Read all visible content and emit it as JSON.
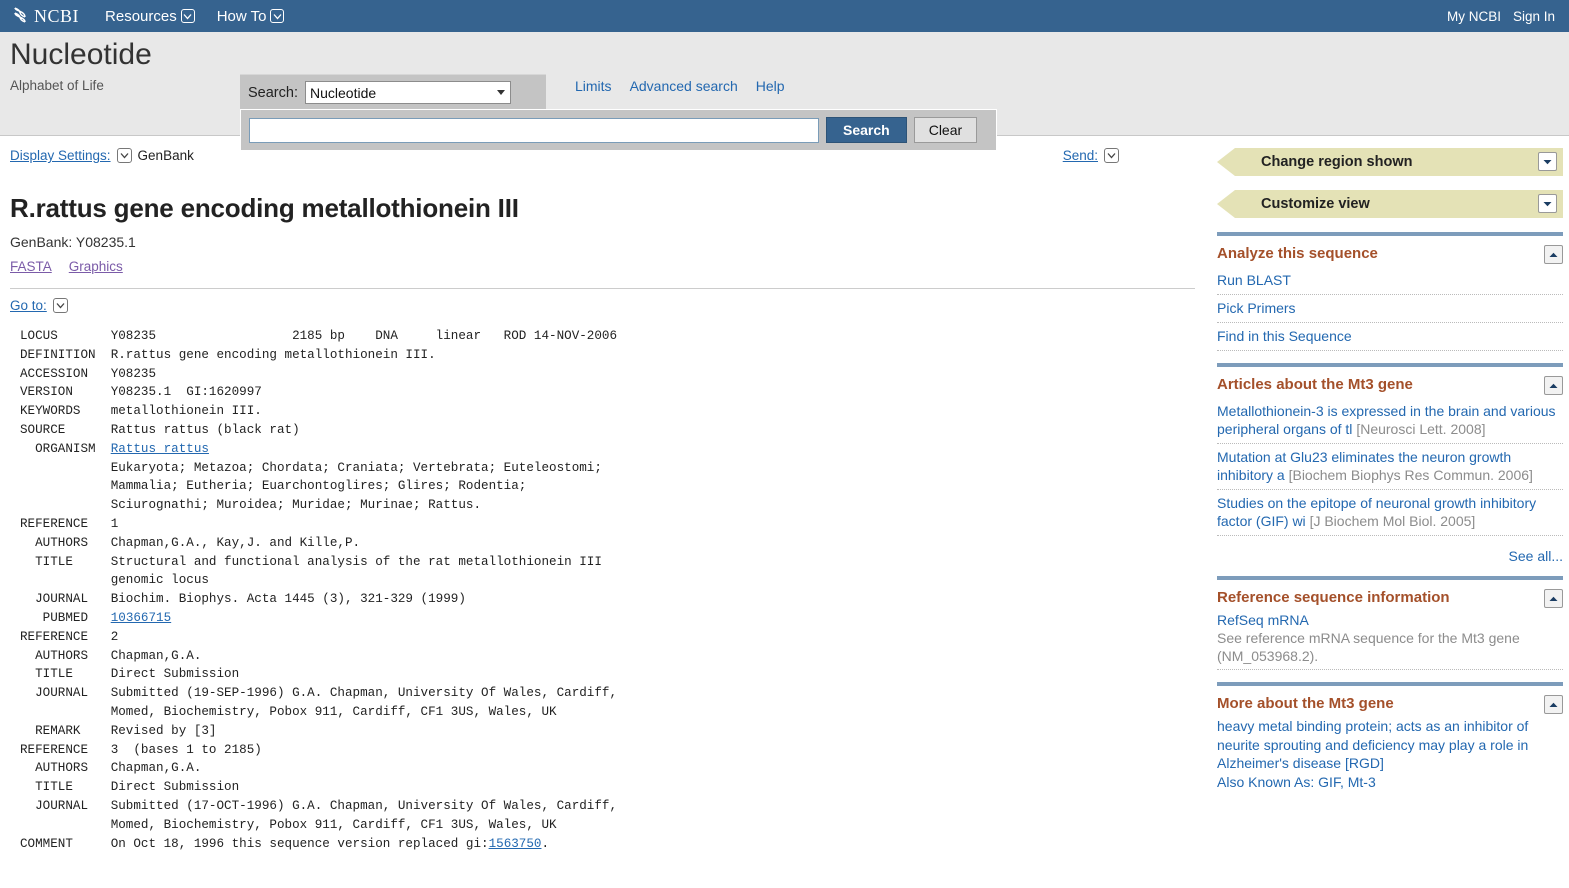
{
  "topbar": {
    "logo_text": "NCBI",
    "nav": [
      {
        "label": "Resources",
        "icon": "chevron-down-icon"
      },
      {
        "label": "How To",
        "icon": "chevron-down-icon"
      }
    ],
    "my_ncbi": "My NCBI",
    "sign_in": "Sign In"
  },
  "header": {
    "database_name": "Nucleotide",
    "tagline": "Alphabet of Life",
    "search_label": "Search:",
    "database_selected": "Nucleotide",
    "search_value": "",
    "search_placeholder": "",
    "search_button": "Search",
    "clear_button": "Clear",
    "links": [
      "Limits",
      "Advanced search",
      "Help"
    ]
  },
  "toolbar": {
    "display_settings": "Display Settings:",
    "display_format": "GenBank",
    "send": "Send:",
    "goto": "Go to:"
  },
  "record": {
    "title": "R.rattus gene encoding metallothionein III",
    "accession_line": "GenBank: Y08235.1",
    "links": [
      "FASTA",
      "Graphics"
    ]
  },
  "genbank": {
    "lines": [
      "LOCUS       Y08235                  2185 bp    DNA     linear   ROD 14-NOV-2006",
      "DEFINITION  R.rattus gene encoding metallothionein III.",
      "ACCESSION   Y08235",
      "VERSION     Y08235.1  GI:1620997",
      "KEYWORDS    metallothionein III.",
      "SOURCE      Rattus rattus (black rat)",
      "  ORGANISM  @LINK:Rattus rattus@",
      "            Eukaryota; Metazoa; Chordata; Craniata; Vertebrata; Euteleostomi;",
      "            Mammalia; Eutheria; Euarchontoglires; Glires; Rodentia;",
      "            Sciurognathi; Muroidea; Muridae; Murinae; Rattus.",
      "REFERENCE   1",
      "  AUTHORS   Chapman,G.A., Kay,J. and Kille,P.",
      "  TITLE     Structural and functional analysis of the rat metallothionein III",
      "            genomic locus",
      "  JOURNAL   Biochim. Biophys. Acta 1445 (3), 321-329 (1999)",
      "   PUBMED   @LINK:10366715@",
      "REFERENCE   2",
      "  AUTHORS   Chapman,G.A.",
      "  TITLE     Direct Submission",
      "  JOURNAL   Submitted (19-SEP-1996) G.A. Chapman, University Of Wales, Cardiff,",
      "            Momed, Biochemistry, Pobox 911, Cardiff, CF1 3US, Wales, UK",
      "  REMARK    Revised by [3]",
      "REFERENCE   3  (bases 1 to 2185)",
      "  AUTHORS   Chapman,G.A.",
      "  TITLE     Direct Submission",
      "  JOURNAL   Submitted (17-OCT-1996) G.A. Chapman, University Of Wales, Cardiff,",
      "            Momed, Biochemistry, Pobox 911, Cardiff, CF1 3US, Wales, UK",
      "COMMENT     On Oct 18, 1996 this sequence version replaced gi:@LINK:1563750@."
    ]
  },
  "sidebar": {
    "ribbons": [
      {
        "label": "Change region shown",
        "icon": "chevron-down-icon"
      },
      {
        "label": "Customize view",
        "icon": "chevron-down-icon"
      }
    ],
    "panels": [
      {
        "title": "Analyze this sequence",
        "collapse_icon": "chevron-up-icon",
        "links": [
          "Run BLAST",
          "Pick Primers",
          "Find in this Sequence"
        ]
      },
      {
        "title": "Articles about the Mt3 gene",
        "collapse_icon": "chevron-up-icon",
        "articles": [
          {
            "text": "Metallothionein-3 is expressed in the brain and various peripheral organs of tl",
            "cite": "[Neurosci Lett. 2008]"
          },
          {
            "text": "Mutation at Glu23 eliminates the neuron growth inhibitory a",
            "cite": "[Biochem Biophys Res Commun. 2006]"
          },
          {
            "text": "Studies on the epitope of neuronal growth inhibitory factor (GIF) wi",
            "cite": "[J Biochem Mol Biol. 2005]"
          }
        ],
        "see_all": "See all..."
      },
      {
        "title": "Reference sequence information",
        "collapse_icon": "chevron-up-icon",
        "refseq_title": "RefSeq mRNA",
        "refseq_desc": "See reference mRNA sequence for the Mt3 gene (NM_053968.2)."
      },
      {
        "title": "More about the Mt3 gene",
        "collapse_icon": "chevron-up-icon",
        "body": "heavy metal binding protein; acts as an inhibitor of neurite sprouting and deficiency may play a role in Alzheimer's disease [RGD]",
        "aka": "Also Known As: GIF, Mt-3"
      }
    ]
  },
  "colors": {
    "header_blue": "#36638f",
    "link_blue": "#2368b0",
    "ribbon_khaki": "#e4e2b6",
    "panel_title_brown": "#a4502a",
    "panel_bar_blue": "#7d9cbb",
    "purple_link": "#7b5ba8"
  }
}
